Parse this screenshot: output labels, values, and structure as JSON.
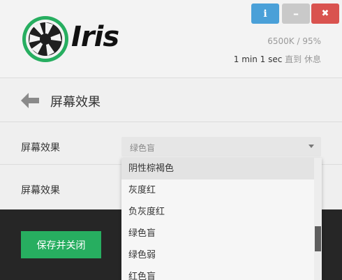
{
  "window": {
    "info_label": "i",
    "minimize_label": "–",
    "close_label": "✖"
  },
  "brand": {
    "name": "Iris",
    "accent_color": "#27ae60",
    "logo_icon": "aperture-icon"
  },
  "status": {
    "color_temp": "6500K / 95%",
    "timer_value": "1 min 1 sec",
    "timer_suffix": "直到 休息"
  },
  "page": {
    "back_icon": "back-arrow-icon",
    "title": "屏幕效果"
  },
  "settings": {
    "row1_label": "屏幕效果",
    "row1_value": "绿色盲",
    "row2_label": "屏幕效果"
  },
  "dropdown": {
    "items": [
      "阴性棕褐色",
      "灰度红",
      "负灰度红",
      "绿色盲",
      "绿色弱",
      "红色盲"
    ]
  },
  "footer": {
    "save_label": "保存并关闭"
  }
}
